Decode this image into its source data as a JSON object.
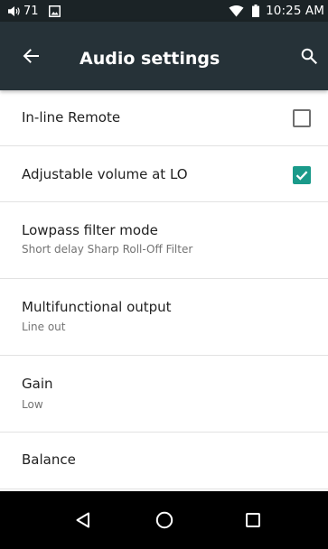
{
  "status_bar": {
    "volume_level": "71",
    "time": "10:25 AM",
    "icons": [
      "volume-icon",
      "gallery-icon",
      "wifi-icon",
      "battery-icon"
    ]
  },
  "app_bar": {
    "title": "Audio settings",
    "back_icon": "arrow-back-icon",
    "search_icon": "search-icon"
  },
  "settings": [
    {
      "title": "In-line Remote",
      "checkbox": "unchecked"
    },
    {
      "title": "Adjustable volume at LO",
      "checkbox": "checked"
    },
    {
      "title": "Lowpass filter mode",
      "summary": "Short delay Sharp Roll-Off Filter"
    },
    {
      "title": "Multifunctional output",
      "summary": "Line out"
    },
    {
      "title": "Gain",
      "summary": "Low"
    },
    {
      "title": "Balance"
    }
  ],
  "nav_bar": {
    "buttons": [
      "back-triangle-icon",
      "home-circle-icon",
      "recents-square-icon"
    ]
  },
  "colors": {
    "status_bar_bg": "#1b2326",
    "app_bar_bg": "#263238",
    "accent": "#1a9a8a",
    "nav_bar_bg": "#000000"
  }
}
